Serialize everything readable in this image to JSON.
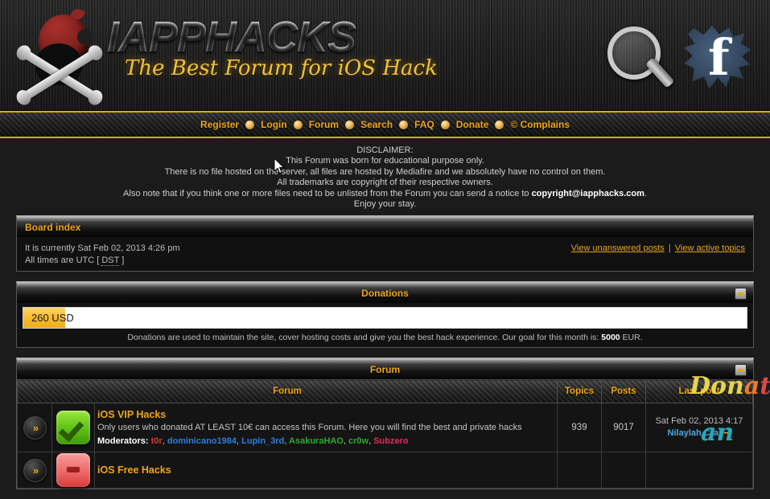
{
  "site": {
    "brand_title": "IAPPHACKS",
    "brand_subtitle": "The Best Forum for iOS Hack",
    "logo_icon": "pirate-apple-skull-icon",
    "search_icon": "magnifier-icon",
    "facebook_icon": "facebook-icon",
    "facebook_letter": "f"
  },
  "nav": {
    "items": [
      {
        "label": "Register"
      },
      {
        "label": "Login"
      },
      {
        "label": "Forum"
      },
      {
        "label": "Search"
      },
      {
        "label": "FAQ"
      },
      {
        "label": "Donate"
      },
      {
        "label": "© Complains"
      }
    ]
  },
  "disclaimer": {
    "line1": "DISCLAIMER:",
    "line2": "This Forum was born for educational purpose only.",
    "line3": "There is no file hosted on the server, all files are hosted by Mediafire and we absolutely have no control on them.",
    "line4": "All trademarks are copyright of their respective owners.",
    "line5_pre": "Also note that if you think one or more files need to be unlisted from the Forum you can send a notice to ",
    "line5_email": "copyright@iapphacks.com",
    "line5_post": ".",
    "line6": "Enjoy your stay."
  },
  "board_index": {
    "title": "Board index",
    "current_time": "It is currently Sat Feb 02, 2013 4:26 pm",
    "times_prefix": "All times are UTC [ ",
    "times_dst": "DST",
    "times_suffix": " ]",
    "link_unanswered": "View unanswered posts",
    "link_separator": "|",
    "link_active": "View active topics"
  },
  "donations": {
    "title": "Donations",
    "collapse_icon": "minimize-icon",
    "amount_value": "260 USD",
    "progress_percent": 5.8,
    "note_pre": "Donations are used to maintain the site, cover hosting costs and give you the best hack experience. Our goal for this month is: ",
    "note_goal": "5000",
    "note_post": " EUR.",
    "accent_color": "#f0ad18"
  },
  "forum_panel": {
    "title": "Forum",
    "collapse_icon": "minimize-icon",
    "columns": {
      "forum": "Forum",
      "topics": "Topics",
      "posts": "Posts",
      "last_post": "Last post"
    },
    "rows": [
      {
        "arrow_icon": "double-chevron-icon",
        "status_icon": "forum-unread-green-check-icon",
        "status_color": "green",
        "title": "iOS VIP Hacks",
        "description": "Only users who donated AT LEAST 10€ can access this Forum. Here you will find the best and private hacks",
        "moderators_label": "Moderators:",
        "moderators": [
          {
            "name": "t0r",
            "color": "#e03030"
          },
          {
            "name": "dominicano1984",
            "color": "#2a7fe0"
          },
          {
            "name": "Lupin_3rd",
            "color": "#2a7fe0"
          },
          {
            "name": "AsakuraHAO",
            "color": "#2fa832"
          },
          {
            "name": "cr0w",
            "color": "#2fa832"
          },
          {
            "name": "Subzero",
            "color": "#e02a5a"
          }
        ],
        "topics": "939",
        "posts": "9017",
        "last_post_date": "Sat Feb 02, 2013 4:17",
        "last_post_author": "Nilaylah Crai",
        "last_post_goto_icon": "goto-last-post-icon"
      },
      {
        "arrow_icon": "double-chevron-icon",
        "status_icon": "forum-locked-red-icon",
        "status_color": "red",
        "title": "iOS Free Hacks",
        "description": "",
        "moderators_label": "",
        "moderators": [],
        "topics": "",
        "posts": "",
        "last_post_date": "",
        "last_post_author": "",
        "last_post_goto_icon": ""
      }
    ]
  },
  "overlay_ad": {
    "word1_part1": "Don",
    "word1_part2": "a",
    "word1_part3": "t",
    "word2": "an"
  }
}
